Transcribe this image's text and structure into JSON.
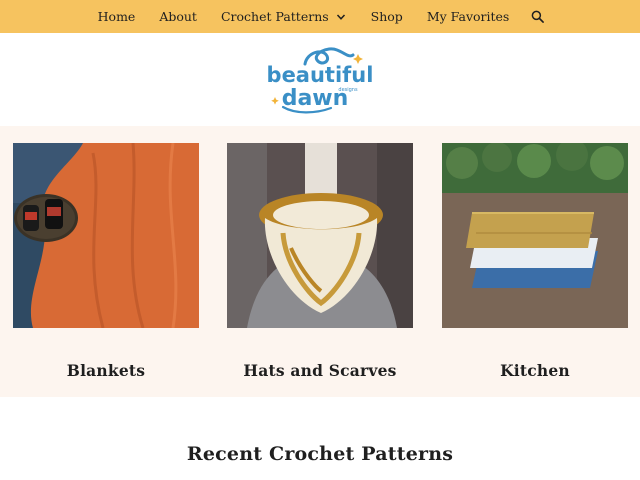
{
  "nav": {
    "items": [
      {
        "label": "Home"
      },
      {
        "label": "About"
      },
      {
        "label": "Crochet Patterns"
      },
      {
        "label": "Shop"
      },
      {
        "label": "My Favorites"
      }
    ],
    "search_icon": "search-icon",
    "dropdown_icon": "chevron-down-icon"
  },
  "logo": {
    "line1": "beautiful",
    "line2": "dawn",
    "small": "designs",
    "color": "#3a8fc6"
  },
  "categories": [
    {
      "label": "Blankets"
    },
    {
      "label": "Hats and Scarves"
    },
    {
      "label": "Kitchen"
    }
  ],
  "recent": {
    "heading": "Recent Crochet Patterns"
  },
  "colors": {
    "nav_bg": "#f6c35f",
    "section_bg": "#fdf5ef",
    "logo_blue": "#3a8fc6",
    "spark_yellow": "#f2b43a"
  }
}
